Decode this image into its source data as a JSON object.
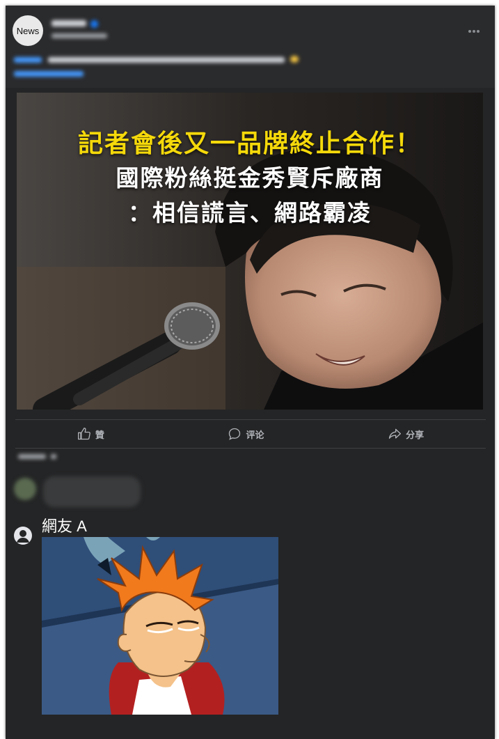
{
  "post": {
    "avatar_label": "News",
    "image_headline": {
      "line1": "記者會後又一品牌終止合作！",
      "line2": "國際粉絲挺金秀賢斥廠商",
      "line3": "：相信謊言、網路霸凌"
    }
  },
  "actions": {
    "like_label": "贊",
    "comment_label": "评论",
    "share_label": "分享"
  },
  "comment": {
    "username": "網友 A"
  },
  "icons": {
    "like": "thumbs-up-icon",
    "comment": "speech-bubble-icon",
    "share": "share-arrow-icon",
    "user": "user-avatar-icon",
    "more": "more-dots-icon"
  },
  "colors": {
    "background": "#242526",
    "headline_accent": "#f5d90a",
    "link": "#4599ff"
  }
}
